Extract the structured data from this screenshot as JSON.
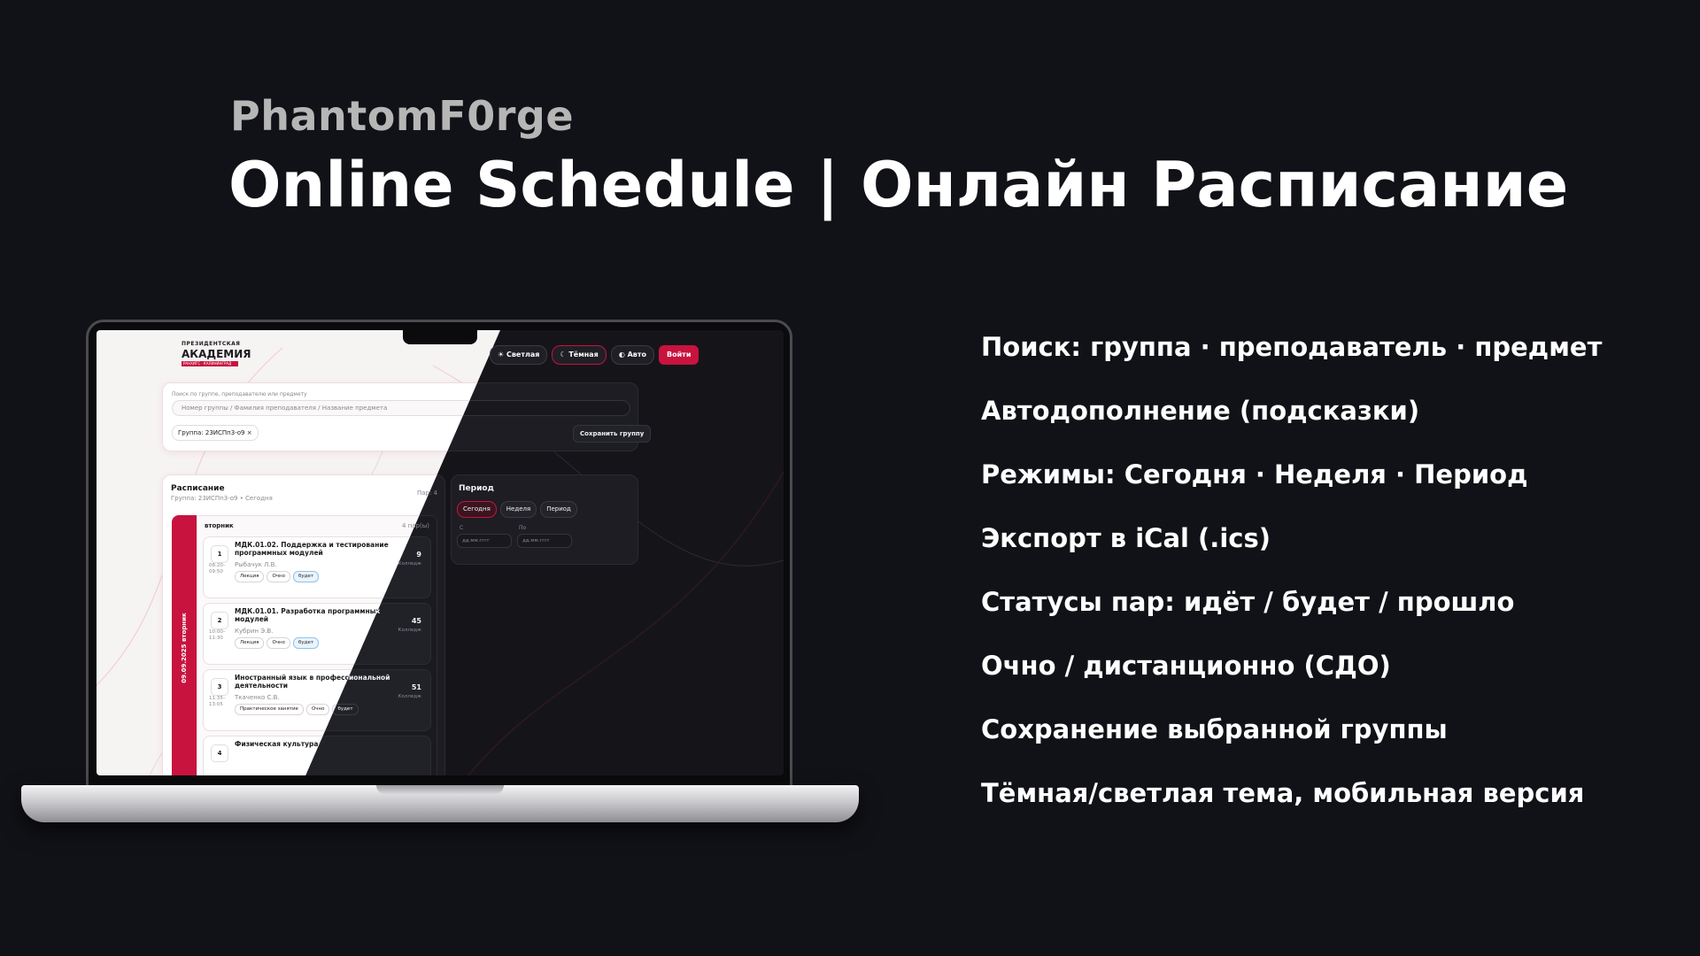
{
  "header": {
    "brand": "PhantomF0rge",
    "title": "Online Schedule | Онлайн Расписание"
  },
  "features": [
    "Поиск: группа · преподаватель · предмет",
    "Автодополнение (подсказки)",
    "Режимы: Сегодня · Неделя · Период",
    "Экспорт в iCal (.ics)",
    "Статусы пар: идёт / будет / прошло",
    "Очно / дистанционно (СДО)",
    "Сохранение выбранной группы",
    "Тёмная/светлая тема, мобильная версия"
  ],
  "colors": {
    "accent": "#c8133f",
    "background": "#111217",
    "future_tag": "#4ea3e6"
  },
  "app": {
    "logo": {
      "line1": "ПРЕЗИДЕНТСКАЯ",
      "line2": "АКАДЕМИЯ",
      "line3": "РАНХИГС · КАЛИНИНГРАД"
    },
    "theme": {
      "light": "Светлая",
      "dark": "Тёмная",
      "auto": "Авто",
      "login": "Войти"
    },
    "icons": {
      "light": "sun-icon",
      "dark": "moon-icon",
      "auto": "auto-icon"
    },
    "search": {
      "label": "Поиск по группе, преподавателю или предмету",
      "placeholder": "Номер группы / Фамилия преподавателя / Название предмета",
      "group_chip": "Группа: 23ИСПп3-о9",
      "save_label": "Сохранить группу"
    },
    "schedule": {
      "title": "Расписание",
      "subtitle": "Группа: 23ИСПп3-о9 • Сегодня",
      "count": "Пар: 4",
      "day_name": "вторник",
      "day_pairs": "4 пар(ы)",
      "day_date": "09.09.2025 вторник",
      "lessons": [
        {
          "num": "1",
          "time": "08:20–09:50",
          "title": "МДК.01.02. Поддержка и тестирование программных модулей",
          "teacher": "Рыбачук Л.В.",
          "room": "9",
          "building": "Колледж",
          "tags": [
            "Лекция",
            "Очно",
            "будет"
          ]
        },
        {
          "num": "2",
          "time": "10:00–11:30",
          "title": "МДК.01.01. Разработка программных модулей",
          "teacher": "Кубрин Э.В.",
          "room": "45",
          "building": "Колледж",
          "tags": [
            "Лекция",
            "Очно",
            "будет"
          ]
        },
        {
          "num": "3",
          "time": "11:35–13:05",
          "title": "Иностранный язык в профессиональной деятельности",
          "teacher": "Ткаченко С.В.",
          "room": "51",
          "building": "Колледж",
          "tags": [
            "Практическое занятие",
            "Очно",
            "будет"
          ]
        },
        {
          "num": "4",
          "time": "",
          "title": "Физическая культура",
          "teacher": "",
          "room": "",
          "building": "",
          "tags": []
        }
      ]
    },
    "period": {
      "title": "Период",
      "modes": [
        "Сегодня",
        "Неделя",
        "Период"
      ],
      "active_mode": "Сегодня",
      "from_label": "С",
      "to_label": "По",
      "date_placeholder": "дд.мм.гггг"
    }
  }
}
